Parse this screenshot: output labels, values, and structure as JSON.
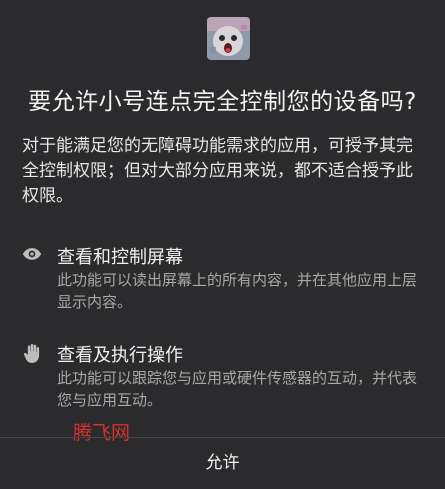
{
  "app": {
    "icon": "app-avatar-icon"
  },
  "dialog": {
    "title": "要允许小号连点完全控制您的设备吗?",
    "description": "对于能满足您的无障碍功能需求的应用，可授予其完全控制权限；但对大部分应用来说，都不适合授予此权限。"
  },
  "permissions": [
    {
      "icon": "eye-icon",
      "title": "查看和控制屏幕",
      "description": "此功能可以读出屏幕上的所有内容，并在其他应用上层显示内容。"
    },
    {
      "icon": "hand-icon",
      "title": "查看及执行操作",
      "description": "此功能可以跟踪您与应用或硬件传感器的互动，并代表您与应用互动。"
    }
  ],
  "watermark": "腾飞网",
  "actions": {
    "allow_label": "允许"
  },
  "colors": {
    "background": "#2b2b2d",
    "watermark": "#d9302a",
    "secondary_text": "#a8a8a8"
  }
}
